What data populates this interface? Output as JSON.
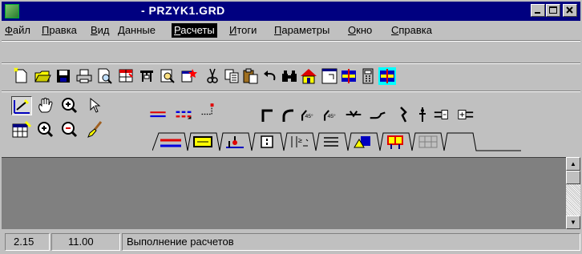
{
  "window": {
    "title": "- PRZYK1.GRD",
    "controls": [
      "minimize",
      "maximize",
      "close"
    ]
  },
  "menu": {
    "items": [
      {
        "accel": "Ф",
        "rest": "айл"
      },
      {
        "accel": "П",
        "rest": "равка"
      },
      {
        "accel": "В",
        "rest": "ид"
      },
      {
        "accel": "Д",
        "rest": "анные"
      },
      {
        "accel": "Р",
        "rest": "асчеты",
        "active": true
      },
      {
        "accel": "И",
        "rest": "тоги"
      },
      {
        "accel": "П",
        "rest": "араметры"
      },
      {
        "accel": "О",
        "rest": "кно"
      },
      {
        "accel": "С",
        "rest": "правка"
      }
    ]
  },
  "toolbar": {
    "icons": [
      "new-file-icon",
      "open-folder-icon",
      "save-icon",
      "print-icon",
      "print-preview-icon",
      "table-red-icon",
      "table-icon",
      "zoom-preview-icon",
      "calc-star-icon",
      "cut-icon",
      "copy-icon",
      "paste-icon",
      "undo-icon",
      "find-icon",
      "home-icon",
      "frame-icon",
      "split-icon",
      "calculator-icon",
      "split-active-icon"
    ]
  },
  "palette": {
    "icons": [
      "draw-icon",
      "hand-pan-icon",
      "zoom-in-icon",
      "pointer-icon",
      "table-edit-icon",
      "zoom-in-round-icon",
      "zoom-out-icon",
      "brush-icon"
    ]
  },
  "elements": {
    "icons": [
      "pipe-line-icon",
      "pipe-end-icon",
      "elbow-90-icon",
      "elbow-round-icon",
      "elbow-45-icon",
      "elbow-45b-icon",
      "valve-icon",
      "curve-icon",
      "bracket-icon",
      "pin-icon",
      "connector-icon",
      "connector2-icon"
    ]
  },
  "tabs": {
    "icons": [
      "tab-lines-icon",
      "tab-radiator-icon",
      "tab-fixture-icon",
      "tab-box-icon",
      "tab-valve-icon",
      "tab-list-icon",
      "tab-shapes-icon",
      "tab-color-icon",
      "tab-grid-icon"
    ]
  },
  "status": {
    "field1": "2.15",
    "field2": "11.00",
    "message": "Выполнение расчетов"
  },
  "colors": {
    "titlebar": "#000080",
    "face": "#c0c0c0",
    "workspace": "#808080"
  }
}
